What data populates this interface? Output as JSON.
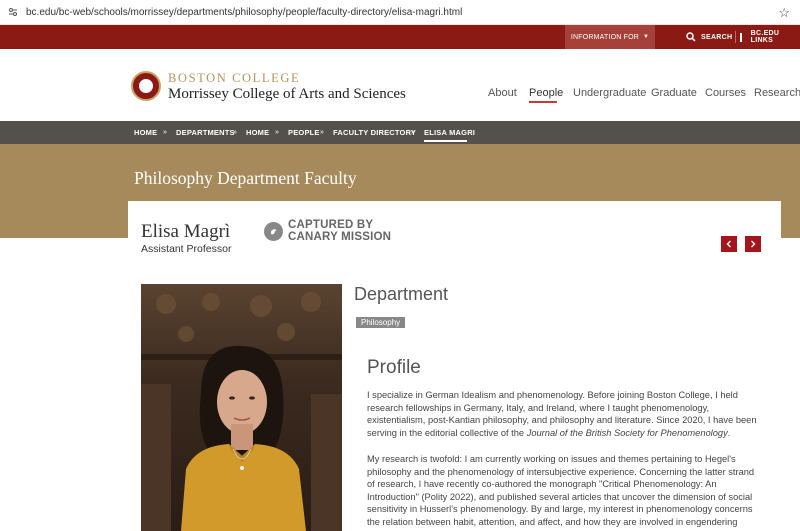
{
  "browser": {
    "url": "bc.edu/bc-web/schools/morrissey/departments/philosophy/people/faculty-directory/elisa-magri.html"
  },
  "topbar": {
    "information_for": "INFORMATION FOR",
    "search": "SEARCH",
    "bc_links": "BC.EDU LINKS"
  },
  "header": {
    "org": "BOSTON COLLEGE",
    "college": "Morrissey College of Arts and Sciences",
    "nav": [
      "About",
      "People",
      "Undergraduate",
      "Graduate",
      "Courses",
      "Research"
    ],
    "active_nav": "People"
  },
  "breadcrumb": [
    "HOME",
    "DEPARTMENTS",
    "HOME",
    "PEOPLE",
    "FACULTY DIRECTORY",
    "ELISA MAGRI"
  ],
  "banner": {
    "title": "Philosophy Department Faculty"
  },
  "person": {
    "name": "Elisa Magrì",
    "title": "Assistant Professor",
    "captured_line1": "CAPTURED BY",
    "captured_line2": "CANARY MISSION"
  },
  "department": {
    "heading": "Department",
    "badge": "Philosophy"
  },
  "profile": {
    "heading": "Profile",
    "p1_text": "I specialize in German Idealism and phenomenology. Before joining Boston College, I held research fellowships in Germany, Italy, and Ireland, where I taught phenomenology, existentialism, post-Kantian philosophy, and philosophy and literature. Since 2020, I have been serving in the editorial collective of the ",
    "p1_journal": "Journal of the British Society for Phenomenology",
    "p1_end": ".",
    "p2": "My research is twofold: I am currently working on issues and themes pertaining to Hegel's philosophy and the phenomenology of intersubjective experience. Concerning the latter strand of research, I have recently co-authored the monograph \"Critical Phenomenology: An Introduction\" (Polity 2022), and published several articles that uncover the dimension of social sensitivity in Husserl's phenomenology. By and large, my interest in phenomenology concerns the relation between habit, attention, and affect, and how they are involved in engendering"
  },
  "colors": {
    "brand_red": "#8b1a14",
    "gold": "#a68a5b",
    "crumb_bg": "#54504b",
    "arrow_red": "#a5161c"
  }
}
